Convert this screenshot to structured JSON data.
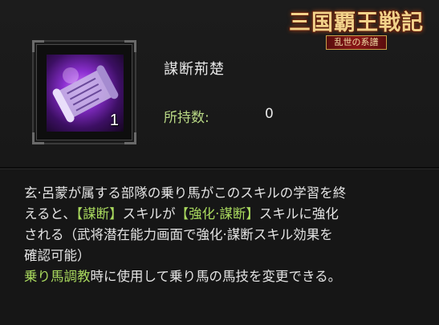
{
  "logo": {
    "title": "三国覇王戦記",
    "subtitle": "乱世の系譜"
  },
  "item": {
    "icon": "skill-scroll-icon",
    "count": "1",
    "name": "謀断荊楚"
  },
  "owned": {
    "label": "所持数:",
    "value": "0"
  },
  "description": {
    "line1": "玄·呂蒙が属する部隊の乗り馬がこのスキルの学習を終",
    "line2_pre": "えると、",
    "line2_hl1": "【謀断】",
    "line2_mid": "スキルが",
    "line2_hl2": "【強化·謀断】",
    "line2_post": "スキルに強化",
    "line3": "される（武将潜在能力画面で強化·謀断スキル効果を",
    "line4": "確認可能）",
    "line5_hl": "乗り馬調教",
    "line5_post": "時に使用して乗り馬の馬技を変更できる。"
  },
  "colors": {
    "highlight": "#a9d95e",
    "icon_glow": "#8b2fd0"
  }
}
